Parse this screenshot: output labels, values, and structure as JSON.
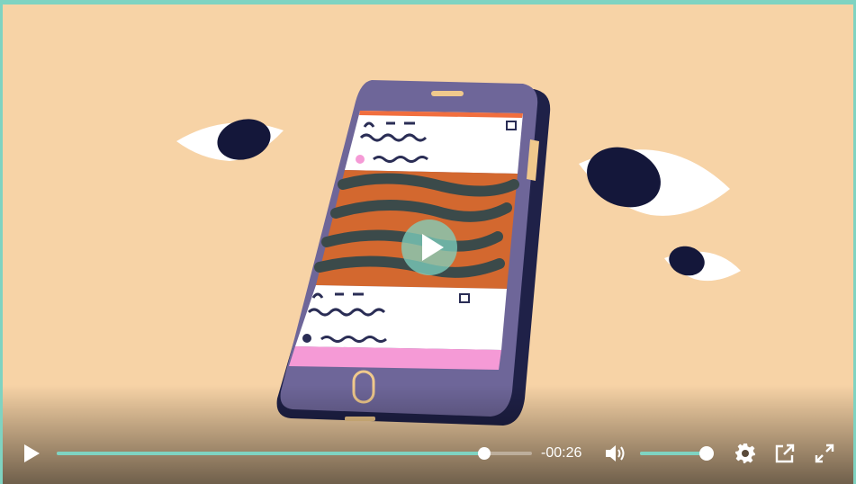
{
  "player": {
    "remaining_time": "-00:26",
    "progress_fraction": 0.9,
    "volume_fraction": 0.95,
    "accent_color": "#7fd3c1",
    "background_color": "#f7d3a6"
  },
  "icons": {
    "play": "play-icon",
    "center_play": "play-icon",
    "volume": "speaker-icon",
    "settings": "gear-icon",
    "popout": "external-link-icon",
    "fullscreen": "expand-icon"
  }
}
